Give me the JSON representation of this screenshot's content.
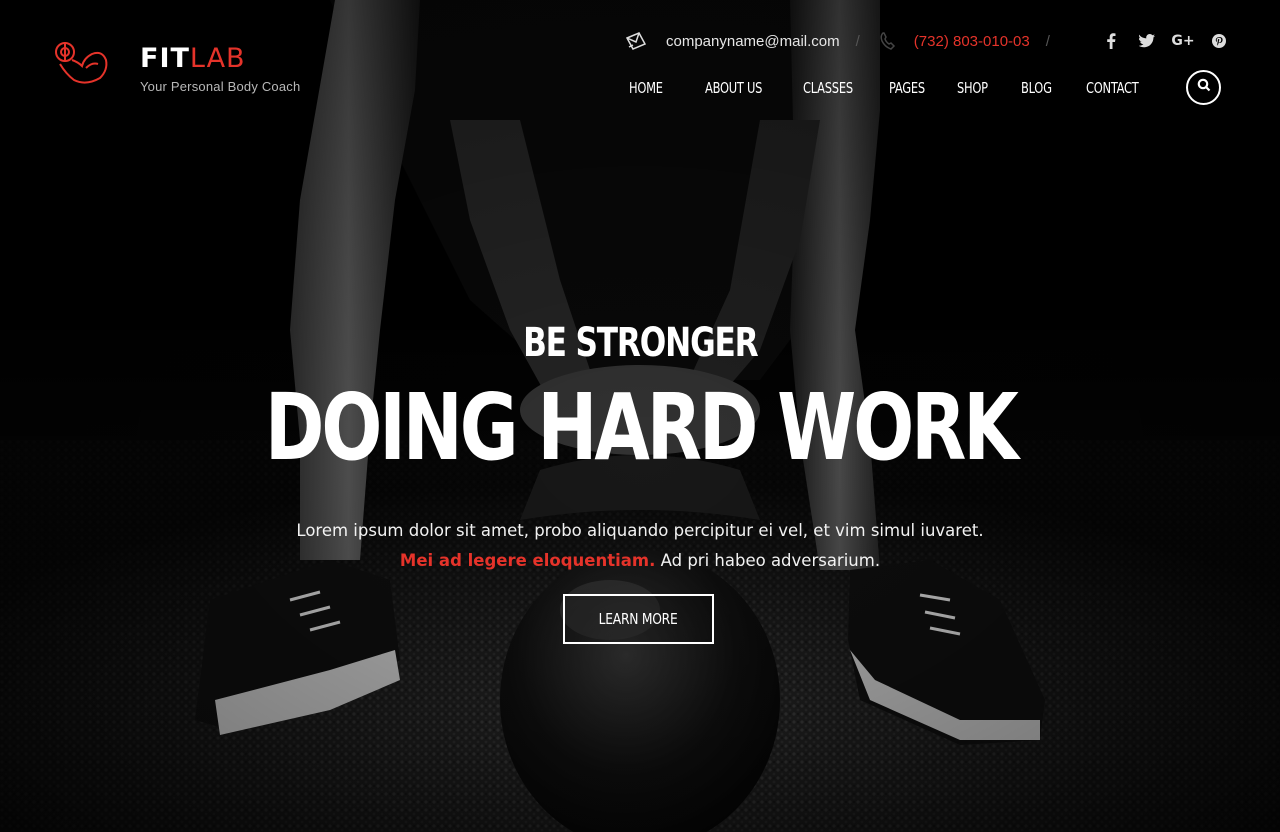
{
  "brand": {
    "name_part1": "FIT",
    "name_part2": "LAB",
    "tagline": "Your Personal Body Coach",
    "accent_color": "#e5332a"
  },
  "contact": {
    "email": "companyname@mail.com",
    "phone": "(732) 803-010-03",
    "email_icon": "envelope-icon",
    "phone_icon": "phone-icon"
  },
  "social": [
    {
      "name": "facebook-icon",
      "glyph": "f"
    },
    {
      "name": "twitter-icon",
      "glyph": "t"
    },
    {
      "name": "google-plus-icon",
      "glyph": "G+"
    },
    {
      "name": "pinterest-icon",
      "glyph": "p"
    }
  ],
  "nav": {
    "items": [
      "HOME",
      "ABOUT US",
      "CLASSES",
      "PAGES",
      "SHOP",
      "BLOG",
      "CONTACT"
    ],
    "search_icon": "search-icon"
  },
  "hero": {
    "kicker": "BE STRONGER",
    "headline": "DOING HARD WORK",
    "line1": "Lorem ipsum dolor sit amet, probo aliquando percipitur ei vel, et vim simul iuvaret.",
    "line2_accent": "Mei ad legere eloquentiam.",
    "line2_rest": " Ad pri habeo adversarium.",
    "cta_label": "LEARN MORE"
  }
}
